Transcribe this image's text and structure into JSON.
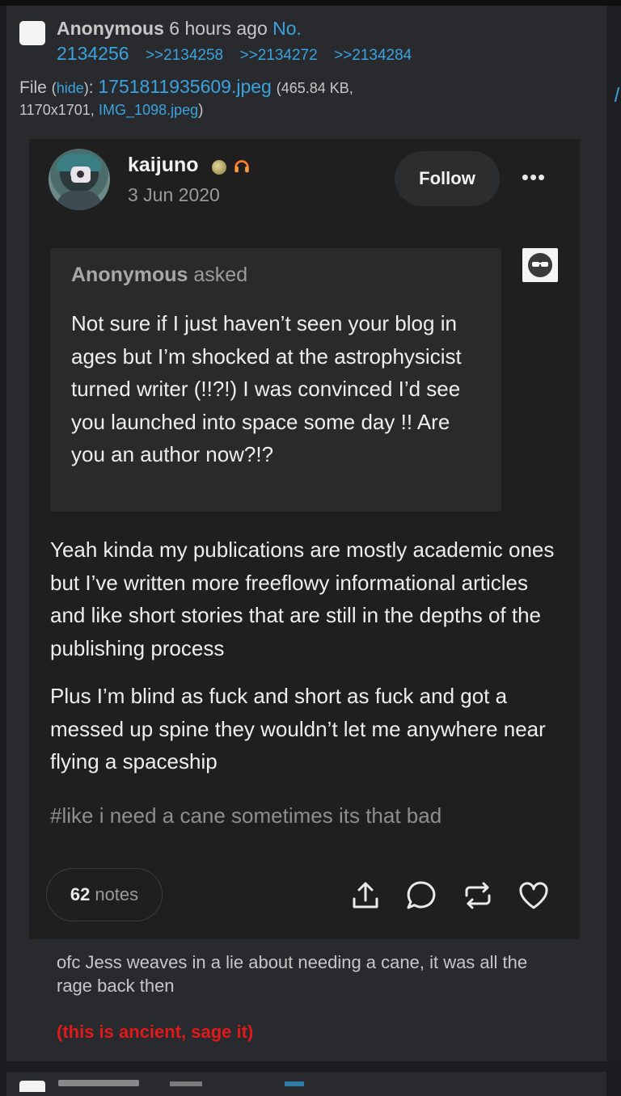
{
  "post": {
    "name": "Anonymous",
    "time": "6 hours ago",
    "no_label": "No.",
    "number": "2134256",
    "replies": [
      ">>2134258",
      ">>2134272",
      ">>2134284"
    ],
    "file_label": "File",
    "hide_label": "hide",
    "filename": "1751811935609.jpeg",
    "size": "465.84 KB,",
    "dimensions": "1170x1701,",
    "original_name": "IMG_1098.jpeg",
    "comment": "ofc Jess weaves in a lie about needing a cane, it was all the rage back then",
    "red_text": "(this is ancient, sage it)"
  },
  "tumblr": {
    "username": "kaijuno",
    "date": "3 Jun 2020",
    "follow_label": "Follow",
    "more_label": "•••",
    "ask": {
      "asker": "Anonymous",
      "asked_label": "asked",
      "text": "Not sure if I just haven’t seen your blog in ages but I’m shocked at the astrophysicist turned writer (!!?!) I was convinced I’d see you launched into space some day !! Are you an author now?!?"
    },
    "answer_p1": "Yeah kinda my publications are mostly academic ones but I’ve written more freeflowy informational articles and like short stories that are still in the depths of the publishing process",
    "answer_p2": "Plus I’m blind as fuck and short as fuck and got a messed up spine they wouldn’t let me anywhere near flying a spaceship",
    "tag": "#like i need a cane sometimes its that bad",
    "notes_count": "62",
    "notes_label": "notes",
    "icons": [
      "share-icon",
      "comment-icon",
      "reblog-icon",
      "heart-icon"
    ]
  },
  "colors": {
    "background": "#1b1d21",
    "post_bg": "#282a2e",
    "link": "#3aa3dd",
    "red_text": "#e0191b"
  }
}
